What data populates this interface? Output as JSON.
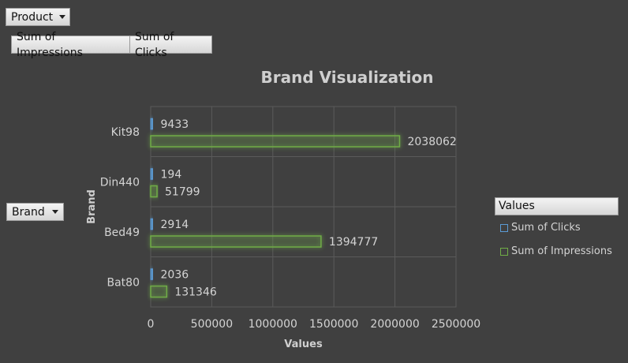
{
  "filters": {
    "product_label": "Product",
    "brand_label": "Brand",
    "value_fields": [
      "Sum of Impressions",
      "Sum of Clicks"
    ]
  },
  "legend": {
    "title": "Values",
    "items": [
      {
        "label": "Sum of Clicks",
        "color": "#5b9bd5"
      },
      {
        "label": "Sum of Impressions",
        "color": "#70ad47"
      }
    ]
  },
  "chart_data": {
    "type": "bar",
    "orientation": "horizontal",
    "title": "Brand Visualization",
    "xlabel": "Values",
    "ylabel": "Brand",
    "categories": [
      "Kit98",
      "Din440",
      "Bed49",
      "Bat80"
    ],
    "series": [
      {
        "name": "Sum of Clicks",
        "values": [
          9433,
          194,
          2914,
          2036
        ],
        "color": "#5b9bd5"
      },
      {
        "name": "Sum of Impressions",
        "values": [
          2038062,
          51799,
          1394777,
          131346
        ],
        "color": "#70ad47"
      }
    ],
    "xlim": [
      0,
      2500000
    ],
    "xticks": [
      "0",
      "500000",
      "1000000",
      "1500000",
      "2000000",
      "2500000"
    ],
    "grid": true,
    "legend_position": "right"
  }
}
